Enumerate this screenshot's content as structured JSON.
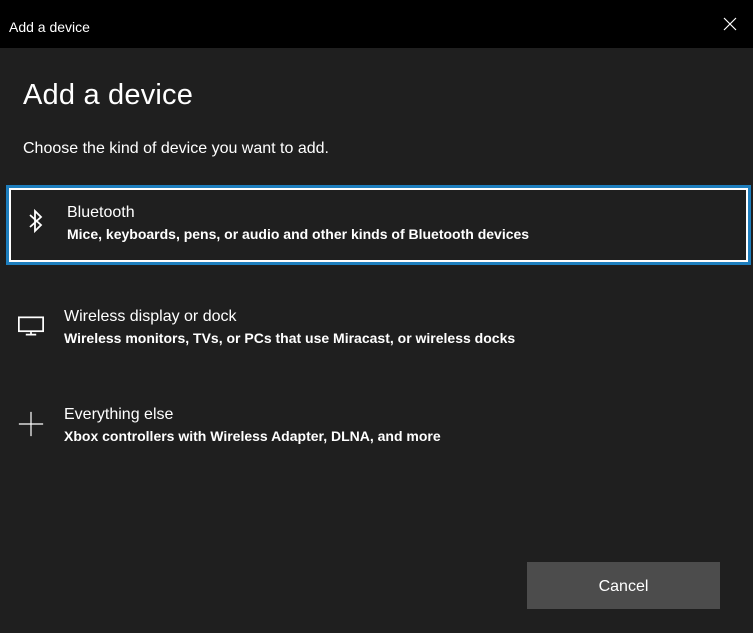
{
  "window": {
    "title": "Add a device"
  },
  "page": {
    "title": "Add a device",
    "subtitle": "Choose the kind of device you want to add."
  },
  "options": [
    {
      "title": "Bluetooth",
      "description": "Mice, keyboards, pens, or audio and other kinds of Bluetooth devices",
      "icon": "bluetooth-icon",
      "selected": true
    },
    {
      "title": "Wireless display or dock",
      "description": "Wireless monitors, TVs, or PCs that use Miracast, or wireless docks",
      "icon": "monitor-icon",
      "selected": false
    },
    {
      "title": "Everything else",
      "description": "Xbox controllers with Wireless Adapter, DLNA, and more",
      "icon": "plus-icon",
      "selected": false
    }
  ],
  "buttons": {
    "cancel": "Cancel"
  },
  "colors": {
    "focus_border": "#1e7fbf",
    "background": "#1f1f1f",
    "titlebar": "#000000",
    "button": "#4c4c4c"
  }
}
